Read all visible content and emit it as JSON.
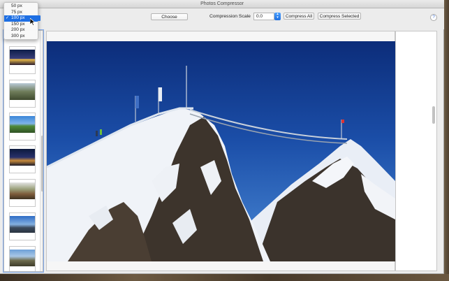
{
  "window": {
    "title": "Photos Compressor"
  },
  "toolbar": {
    "choose_label": "Choose",
    "compression_scale_label": "Compression Scale",
    "compression_scale_value": "0.0",
    "compress_all_label": "Compress All",
    "compress_selected_label": "Compress Selected",
    "help_label": "?"
  },
  "size_menu": {
    "items": [
      "50 px",
      "75 px",
      "100 px",
      "150 px",
      "200 px",
      "300 px"
    ],
    "selected": "100 px",
    "check_mark": "✓"
  },
  "sidebar": {
    "thumbnail_count": 8
  },
  "colors": {
    "accent": "#1e6fe3",
    "sky": "#1b4ea8"
  },
  "icons": [
    "stepper-icon",
    "help-icon",
    "check-icon",
    "cursor-icon"
  ]
}
